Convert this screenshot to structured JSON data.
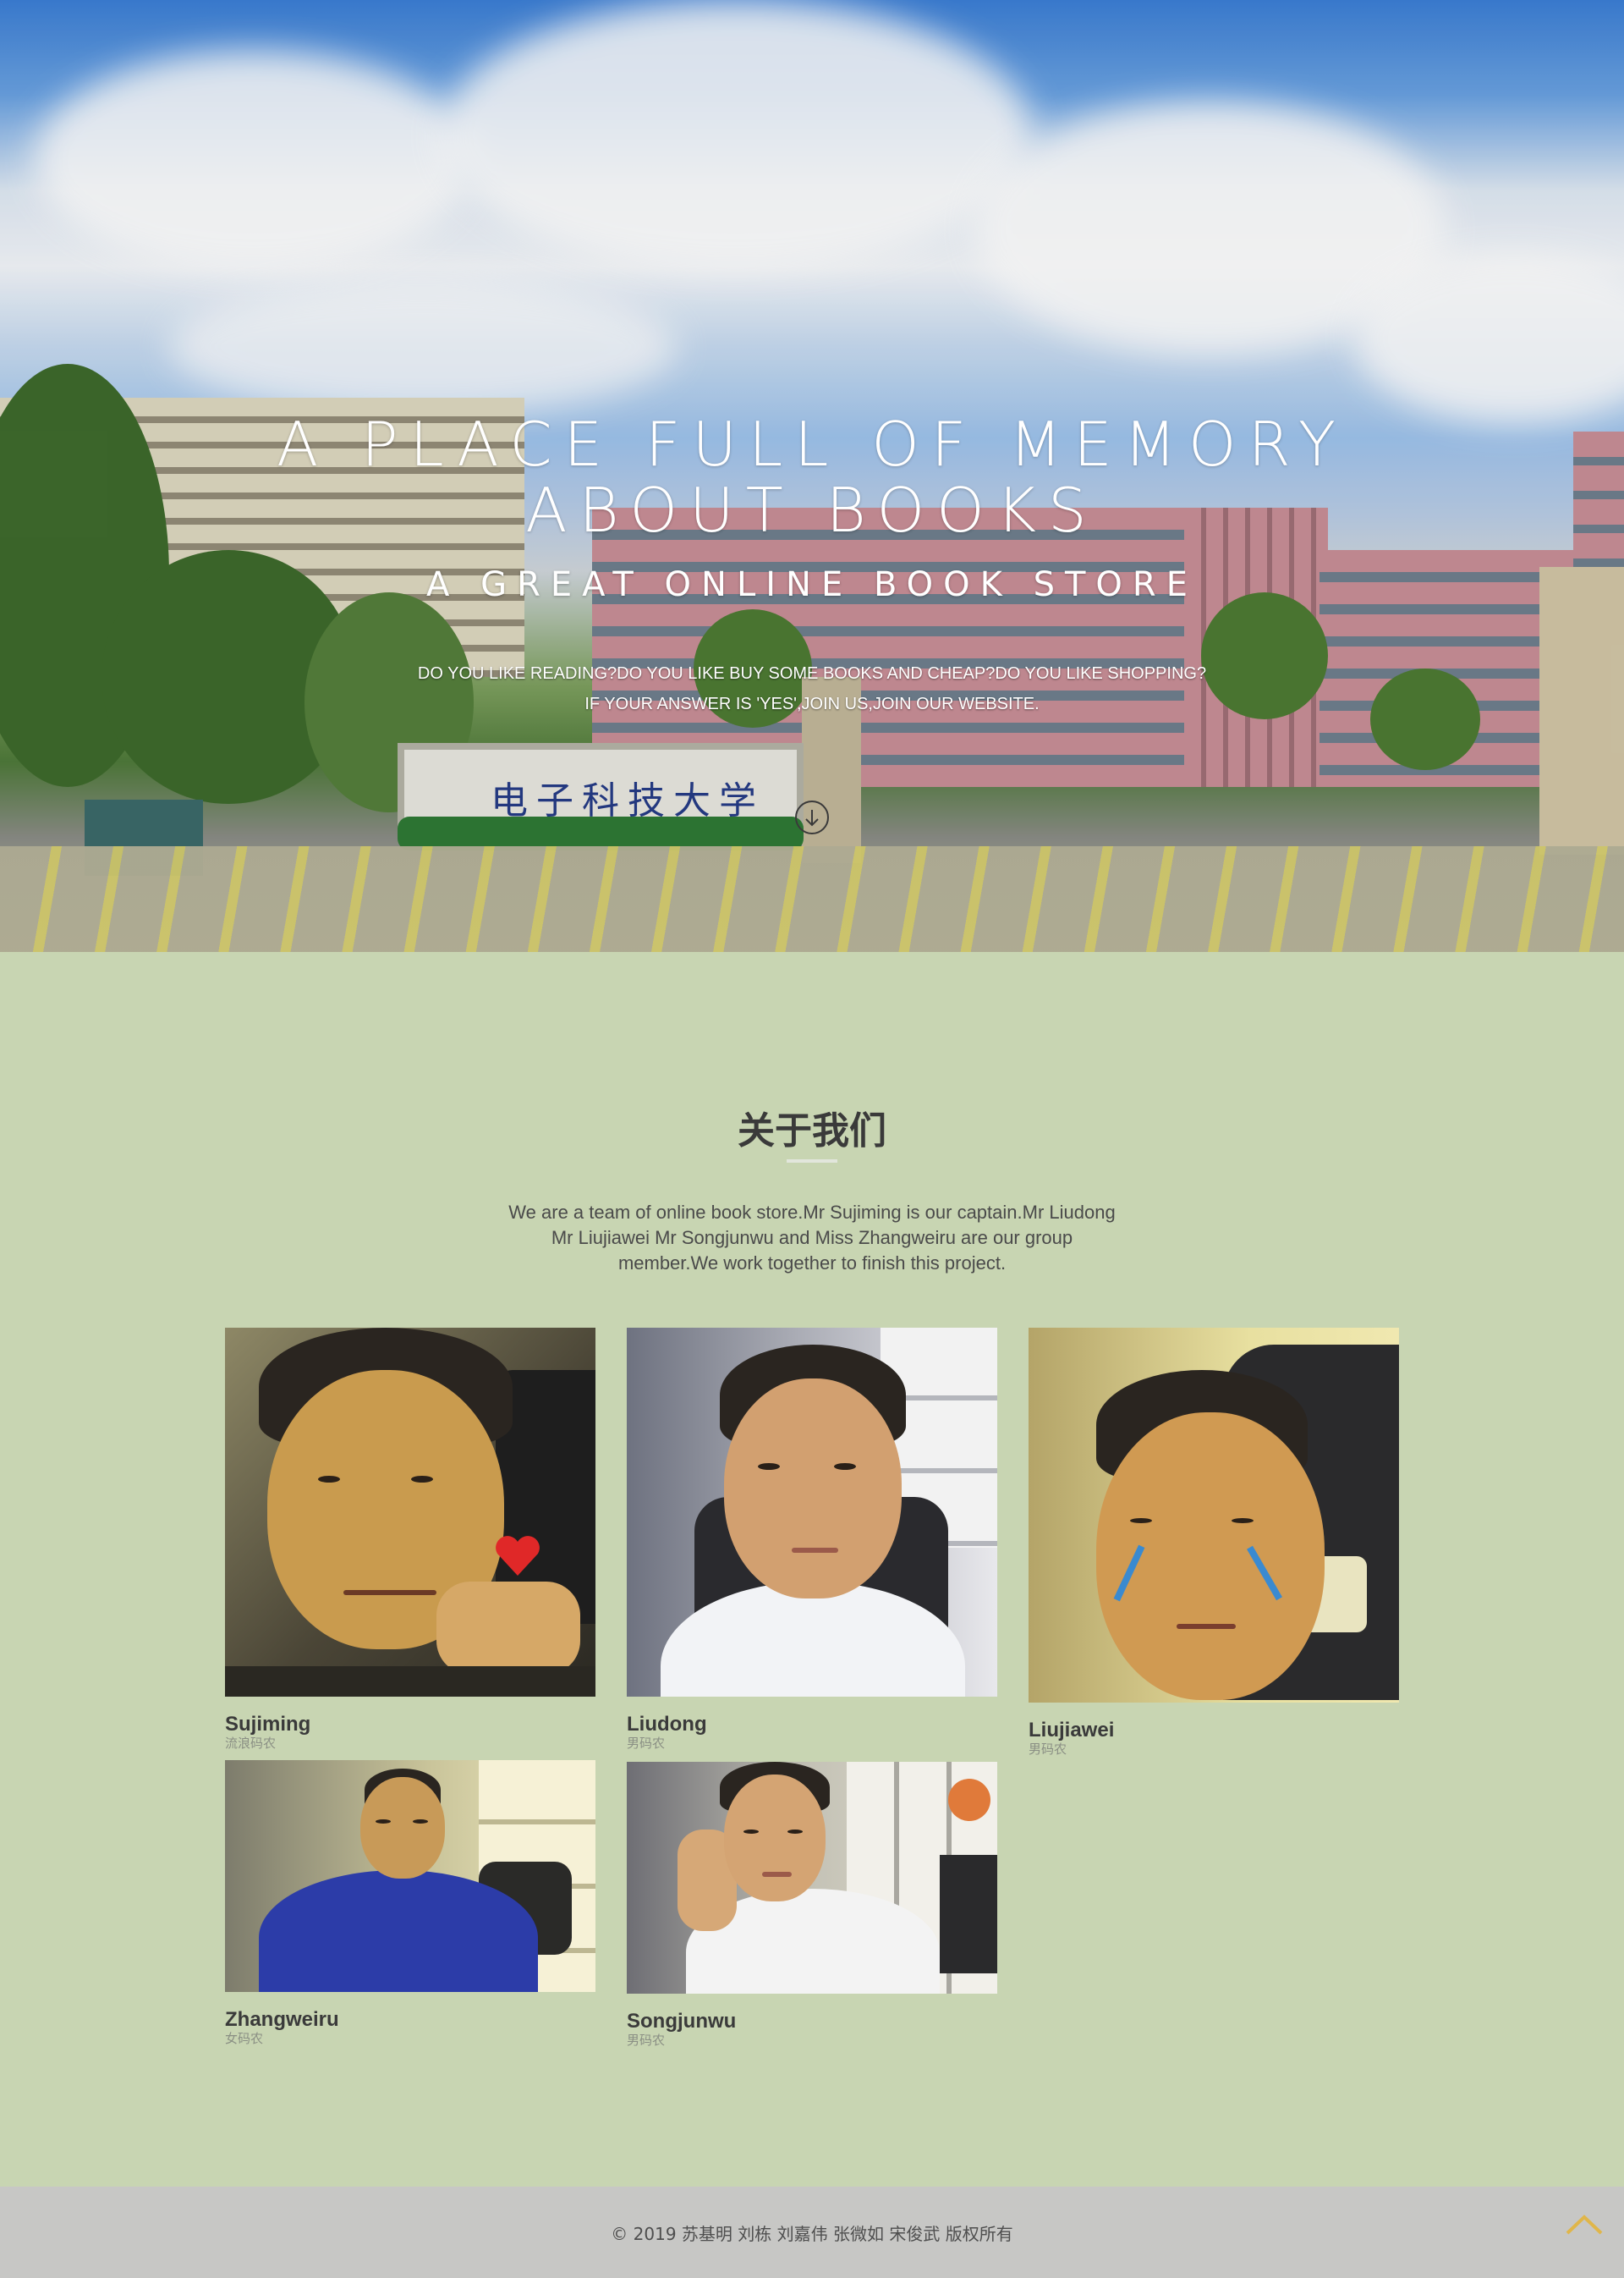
{
  "hero": {
    "title_line1": "A PLACE FULL OF MEMORY",
    "title_line2": "ABOUT BOOKS",
    "subtitle": "A GREAT ONLINE BOOK STORE",
    "desc_line1": "DO YOU LIKE READING?DO YOU LIKE BUY SOME BOOKS AND CHEAP?DO YOU LIKE SHOPPING?",
    "desc_line2": "IF YOUR ANSWER IS 'YES',JOIN US,JOIN OUR WEBSITE.",
    "gate_sign": "电子科技大学",
    "scroll_icon": "arrow-down-circle-icon"
  },
  "about": {
    "title": "关于我们",
    "text_line1": "We are a team of online book store.Mr Sujiming is our captain.Mr Liudong",
    "text_line2": "Mr Liujiawei Mr Songjunwu and Miss Zhangweiru are our group",
    "text_line3": "member.We work together to finish this project."
  },
  "members": [
    {
      "name": "Sujiming",
      "role": "流浪码农"
    },
    {
      "name": "Liudong",
      "role": "男码农"
    },
    {
      "name": "Liujiawei",
      "role": "男码农"
    },
    {
      "name": "Zhangweiru",
      "role": "女码农"
    },
    {
      "name": "Songjunwu",
      "role": "男码农"
    }
  ],
  "footer": {
    "copyright": "© 2019 苏基明 刘栋 刘嘉伟 张微如 宋俊武 版权所有",
    "to_top_icon": "chevron-up-icon"
  },
  "colors": {
    "page_bg": "#c8d5b2",
    "footer_bg": "#c7c7c5",
    "to_top_accent": "#e0b64a",
    "text_dark": "#3a3a3a"
  }
}
